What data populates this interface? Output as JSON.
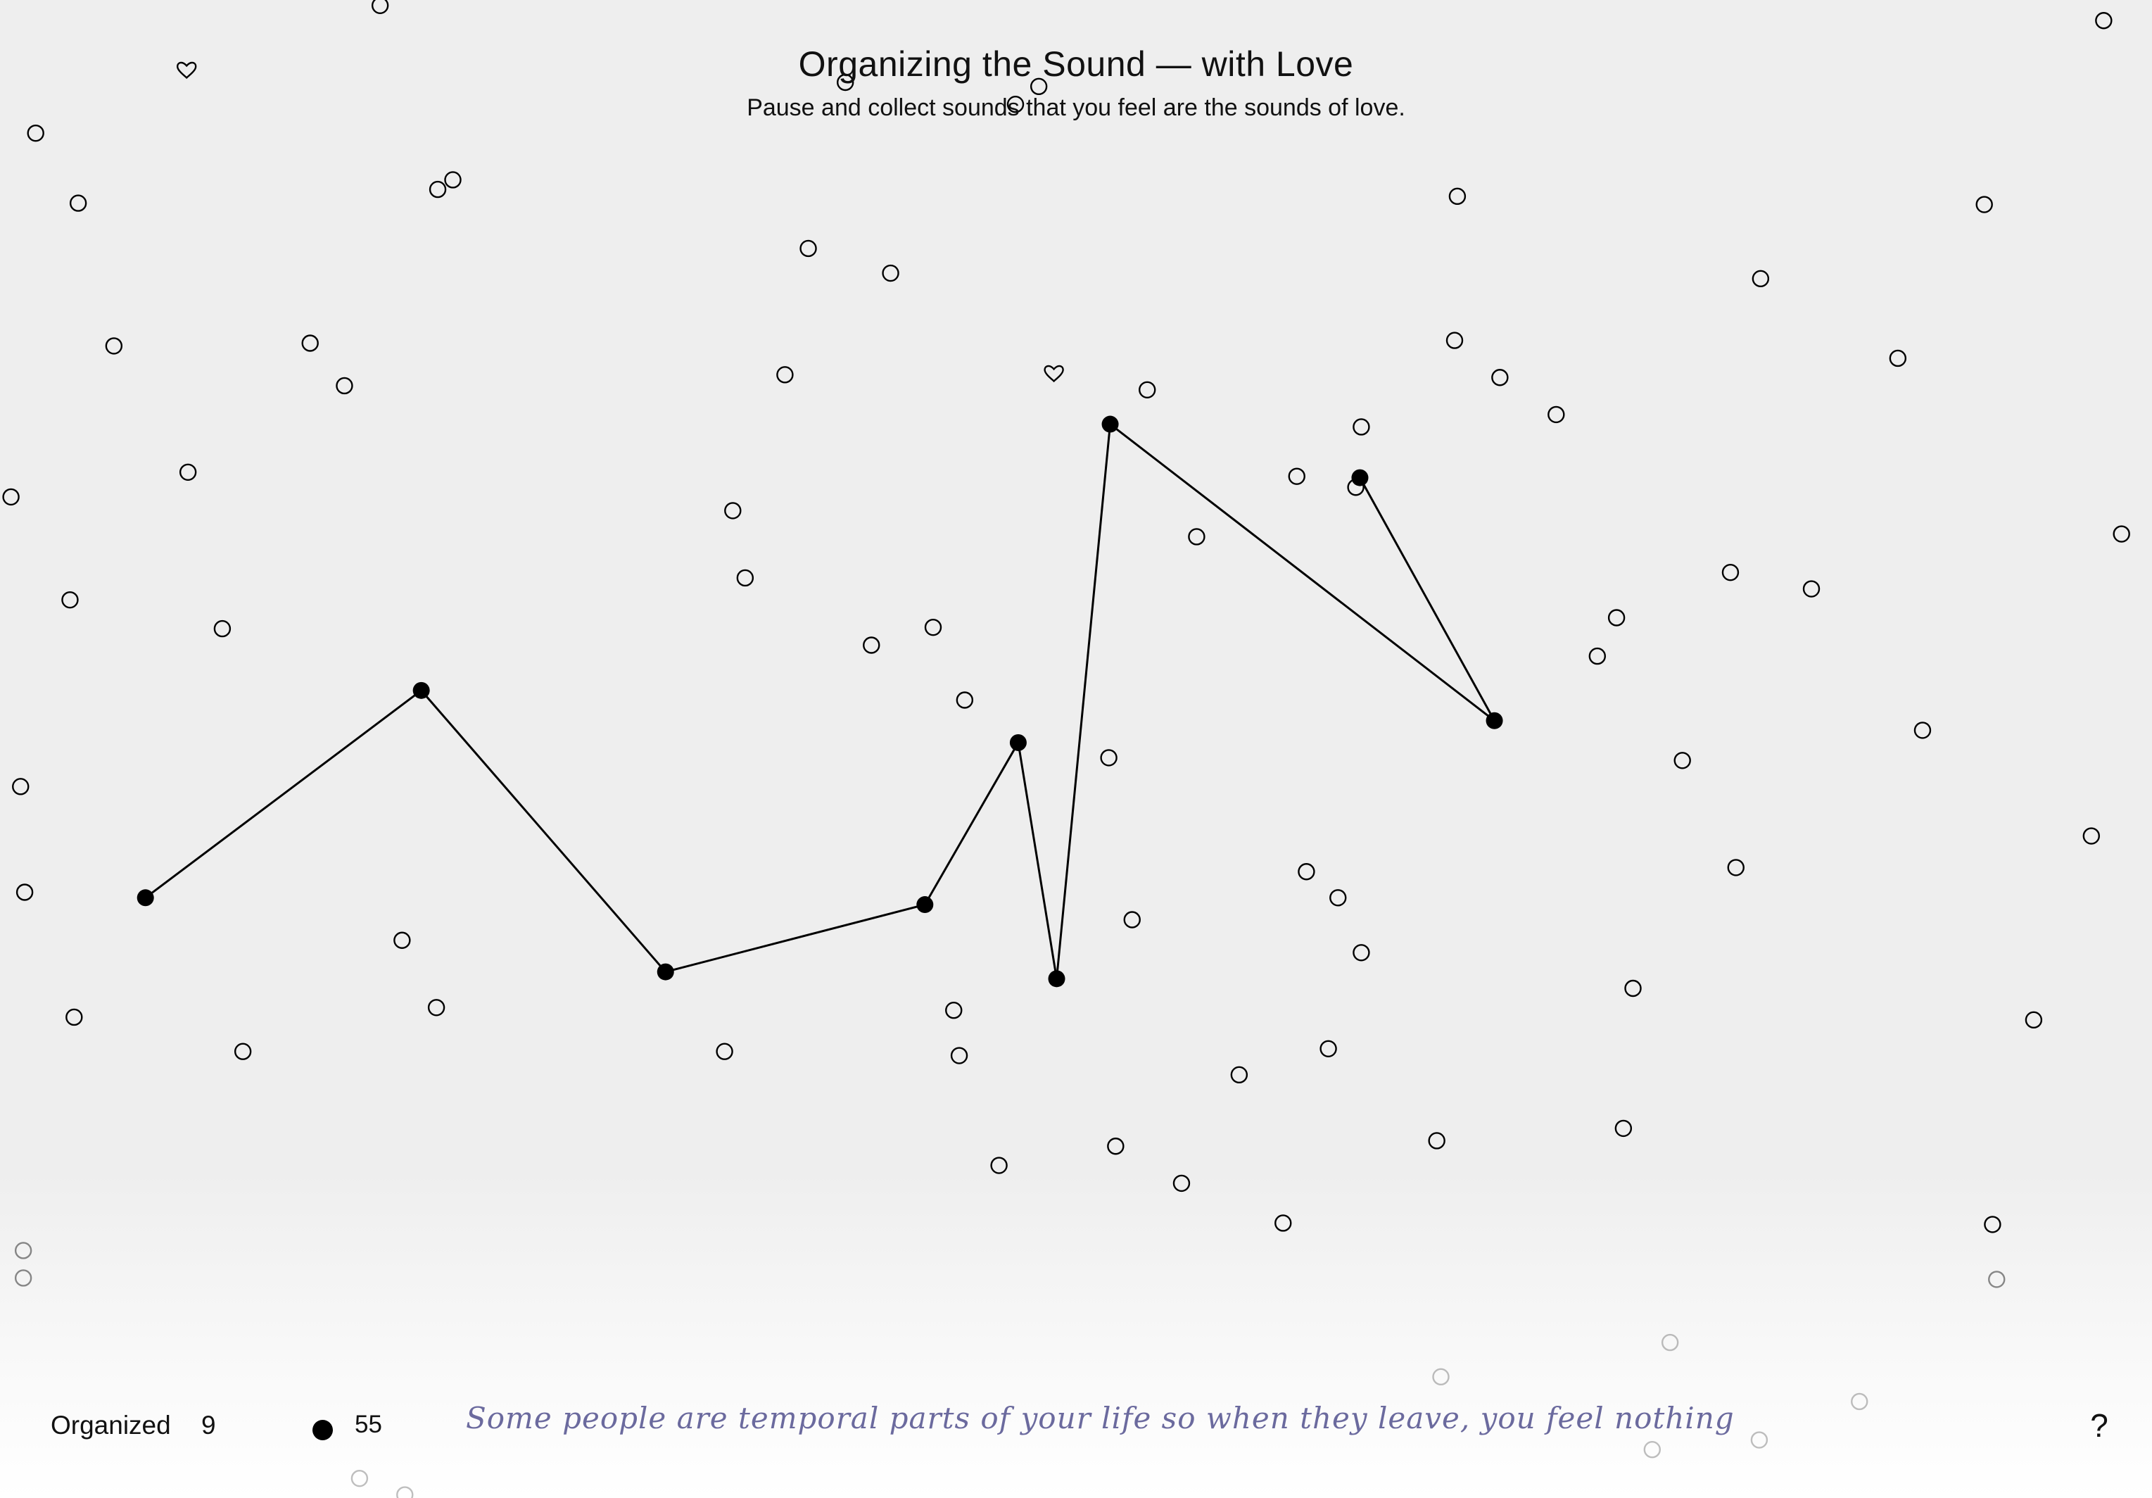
{
  "header": {
    "title": "Organizing the Sound — with Love",
    "subtitle": "Pause and collect sounds that you feel are the sounds of love."
  },
  "footer": {
    "organized_label": "Organized",
    "organized_count": "9",
    "dot_count": "55",
    "quote": "Some people are temporal parts of your life so when they leave, you feel nothing",
    "help_label": "?"
  },
  "colors": {
    "background": "#eeeeee",
    "ink": "#000000",
    "quote": "#6b6a9e"
  },
  "icons": {
    "sound": "open-circle-icon",
    "love_sound": "heart-icon",
    "collected_sound": "filled-dot-icon"
  }
}
